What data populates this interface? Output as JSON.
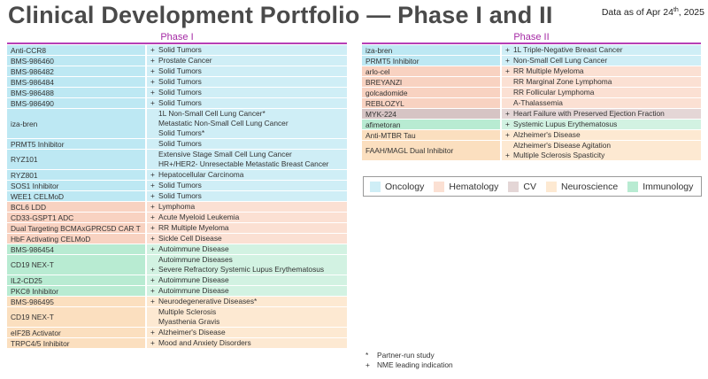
{
  "title": "Clinical Development Portfolio — Phase I and II",
  "as_of": {
    "prefix": "Data as of Apr 24",
    "sup": "th",
    "suffix": ", 2025"
  },
  "colors": {
    "Oncology": "#cfeef6",
    "Hematology": "#fbe0d3",
    "CV": "#e4d6d6",
    "Neuroscience": "#fde9d2",
    "Immunology": "#d2f2e2",
    "accent": "#b63fb6"
  },
  "phase1": {
    "heading": "Phase I",
    "groups": [
      {
        "area": "onc",
        "asset": "Anti-CCR8",
        "inds": [
          {
            "mark": "+",
            "text": "Solid Tumors"
          }
        ]
      },
      {
        "area": "onc",
        "asset": "BMS-986460",
        "inds": [
          {
            "mark": "+",
            "text": "Prostate Cancer"
          }
        ]
      },
      {
        "area": "onc",
        "asset": "BMS-986482",
        "inds": [
          {
            "mark": "+",
            "text": "Solid Tumors"
          }
        ]
      },
      {
        "area": "onc",
        "asset": "BMS-986484",
        "inds": [
          {
            "mark": "+",
            "text": "Solid Tumors"
          }
        ]
      },
      {
        "area": "onc",
        "asset": "BMS-986488",
        "inds": [
          {
            "mark": "+",
            "text": "Solid Tumors"
          }
        ]
      },
      {
        "area": "onc",
        "asset": "BMS-986490",
        "inds": [
          {
            "mark": "+",
            "text": "Solid Tumors"
          }
        ]
      },
      {
        "area": "onc",
        "asset": "iza-bren",
        "inds": [
          {
            "mark": "",
            "text": "1L Non-Small Cell Lung Cancer*"
          },
          {
            "mark": "",
            "text": "Metastatic Non-Small Cell Lung Cancer"
          },
          {
            "mark": "",
            "text": "Solid Tumors*"
          }
        ]
      },
      {
        "area": "onc",
        "asset": "PRMT5 Inhibitor",
        "inds": [
          {
            "mark": "",
            "text": "Solid Tumors"
          }
        ]
      },
      {
        "area": "onc",
        "asset": "RYZ101",
        "inds": [
          {
            "mark": "",
            "text": "Extensive Stage Small Cell Lung Cancer"
          },
          {
            "mark": "",
            "text": "HR+/HER2- Unresectable Metastatic Breast Cancer"
          }
        ]
      },
      {
        "area": "onc",
        "asset": "RYZ801",
        "inds": [
          {
            "mark": "+",
            "text": "Hepatocellular Carcinoma"
          }
        ]
      },
      {
        "area": "onc",
        "asset": "SOS1 Inhibitor",
        "inds": [
          {
            "mark": "+",
            "text": "Solid Tumors"
          }
        ]
      },
      {
        "area": "onc",
        "asset": "WEE1 CELMoD",
        "inds": [
          {
            "mark": "+",
            "text": "Solid Tumors"
          }
        ]
      },
      {
        "area": "hem",
        "asset": "BCL6 LDD",
        "inds": [
          {
            "mark": "+",
            "text": "Lymphoma"
          }
        ]
      },
      {
        "area": "hem",
        "asset": "CD33-GSPT1 ADC",
        "inds": [
          {
            "mark": "+",
            "text": "Acute Myeloid Leukemia"
          }
        ]
      },
      {
        "area": "hem",
        "asset": "Dual Targeting BCMAxGPRC5D CAR T",
        "inds": [
          {
            "mark": "+",
            "text": "RR Multiple Myeloma"
          }
        ]
      },
      {
        "area": "hem",
        "asset": "HbF Activating CELMoD",
        "inds": [
          {
            "mark": "+",
            "text": "Sickle Cell Disease"
          }
        ]
      },
      {
        "area": "imm",
        "asset": "BMS-986454",
        "inds": [
          {
            "mark": "+",
            "text": "Autoimmune Disease"
          }
        ]
      },
      {
        "area": "imm",
        "asset": "CD19 NEX-T",
        "inds": [
          {
            "mark": "",
            "text": "Autoimmune Diseases"
          },
          {
            "mark": "+",
            "text": "Severe Refractory Systemic Lupus Erythematosus"
          }
        ]
      },
      {
        "area": "imm",
        "asset": "IL2-CD25",
        "inds": [
          {
            "mark": "+",
            "text": "Autoimmune Disease"
          }
        ]
      },
      {
        "area": "imm",
        "asset": "PKCθ Inhibitor",
        "inds": [
          {
            "mark": "+",
            "text": "Autoimmune Disease"
          }
        ]
      },
      {
        "area": "neu",
        "asset": "BMS-986495",
        "inds": [
          {
            "mark": "+",
            "text": "Neurodegenerative Diseases*"
          }
        ]
      },
      {
        "area": "neu",
        "asset": "CD19 NEX-T",
        "inds": [
          {
            "mark": "",
            "text": "Multiple Sclerosis"
          },
          {
            "mark": "",
            "text": "Myasthenia Gravis"
          }
        ]
      },
      {
        "area": "neu",
        "asset": "eIF2B Activator",
        "inds": [
          {
            "mark": "+",
            "text": "Alzheimer's Disease"
          }
        ]
      },
      {
        "area": "neu",
        "asset": "TRPC4/5 Inhibitor",
        "inds": [
          {
            "mark": "+",
            "text": "Mood and Anxiety Disorders"
          }
        ]
      }
    ]
  },
  "phase2": {
    "heading": "Phase II",
    "groups": [
      {
        "area": "onc",
        "asset": "iza-bren",
        "inds": [
          {
            "mark": "+",
            "text": "1L Triple-Negative Breast Cancer"
          }
        ]
      },
      {
        "area": "onc",
        "asset": "PRMT5 Inhibitor",
        "inds": [
          {
            "mark": "+",
            "text": "Non-Small Cell Lung Cancer"
          }
        ]
      },
      {
        "area": "hem",
        "asset": "arlo-cel",
        "inds": [
          {
            "mark": "+",
            "text": "RR Multiple Myeloma"
          }
        ]
      },
      {
        "area": "hem",
        "asset": "BREYANZI",
        "inds": [
          {
            "mark": "",
            "text": "RR Marginal Zone Lymphoma"
          }
        ]
      },
      {
        "area": "hem",
        "asset": "golcadomide",
        "inds": [
          {
            "mark": "",
            "text": "RR Follicular Lymphoma"
          }
        ]
      },
      {
        "area": "hem",
        "asset": "REBLOZYL",
        "inds": [
          {
            "mark": "",
            "text": "A-Thalassemia"
          }
        ]
      },
      {
        "area": "cv",
        "asset": "MYK-224",
        "inds": [
          {
            "mark": "+",
            "text": "Heart Failure with Preserved Ejection Fraction"
          }
        ]
      },
      {
        "area": "imm",
        "asset": "afimetoran",
        "inds": [
          {
            "mark": "+",
            "text": "Systemic Lupus Erythematosus"
          }
        ]
      },
      {
        "area": "neu",
        "asset": "Anti-MTBR Tau",
        "inds": [
          {
            "mark": "+",
            "text": "Alzheimer's Disease"
          }
        ]
      },
      {
        "area": "neu",
        "asset": "FAAH/MAGL Dual Inhibitor",
        "inds": [
          {
            "mark": "",
            "text": "Alzheimer's Disease Agitation"
          },
          {
            "mark": "+",
            "text": "Multiple Sclerosis Spasticity"
          }
        ]
      }
    ]
  },
  "legend": [
    {
      "area": "onc",
      "label": "Oncology",
      "color": "#cfeef6"
    },
    {
      "area": "hem",
      "label": "Hematology",
      "color": "#fbe0d3"
    },
    {
      "area": "cv",
      "label": "CV",
      "color": "#e4d6d6"
    },
    {
      "area": "neu",
      "label": "Neuroscience",
      "color": "#fde9d2"
    },
    {
      "area": "imm",
      "label": "Immunology",
      "color": "#b8ebd2"
    }
  ],
  "footnotes": [
    {
      "symbol": "*",
      "text": "Partner-run study"
    },
    {
      "symbol": "+",
      "text": "NME leading indication"
    }
  ]
}
